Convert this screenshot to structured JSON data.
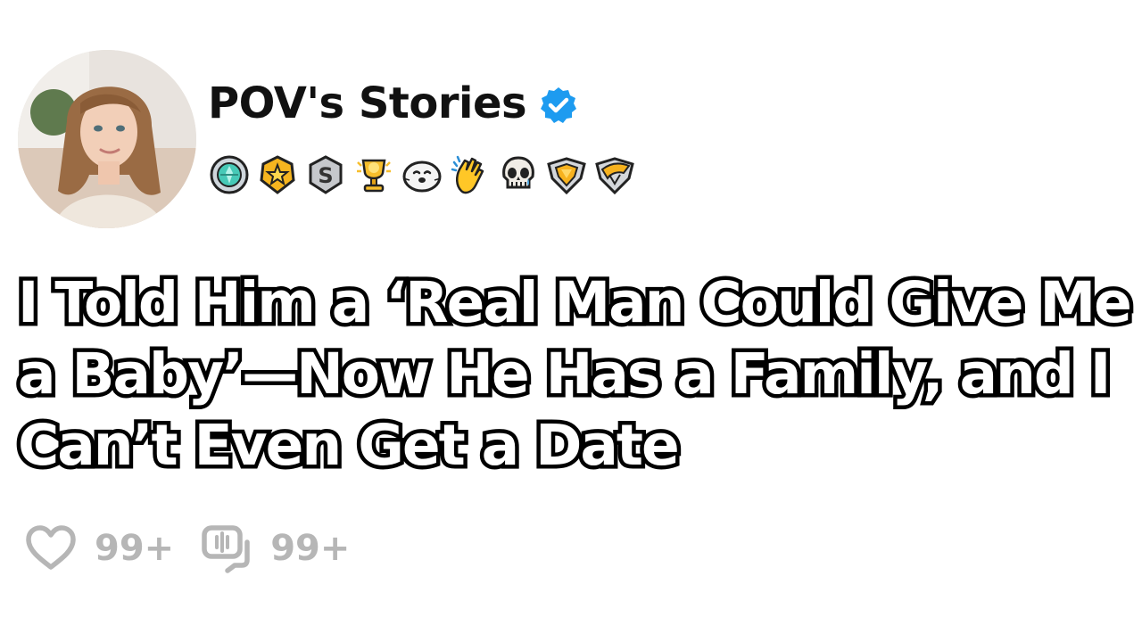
{
  "author": {
    "name": "POV's Stories",
    "verified": true,
    "verified_icon": "verified-badge-icon",
    "avatar_icon": "profile-photo"
  },
  "badges": [
    "crystal-medal-badge",
    "gold-star-badge",
    "silver-s-badge",
    "gold-trophy-badge",
    "seal-face-badge",
    "clapping-hands-badge",
    "crying-skull-badge",
    "gold-heart-shield-badge",
    "gold-wing-shield-badge"
  ],
  "post": {
    "title": "I Told Him a ‘Real Man Could Give Me a Baby’—Now He Has a Family, and I Can’t Even Get a Date"
  },
  "stats": {
    "likes_icon": "heart-icon",
    "likes": "99+",
    "comments_icon": "comment-icon",
    "comments": "99+"
  },
  "colors": {
    "verified": "#1d9bf0",
    "stat_gray": "#b6b6b6",
    "title_fill": "#ffffff",
    "title_stroke": "#000000"
  }
}
